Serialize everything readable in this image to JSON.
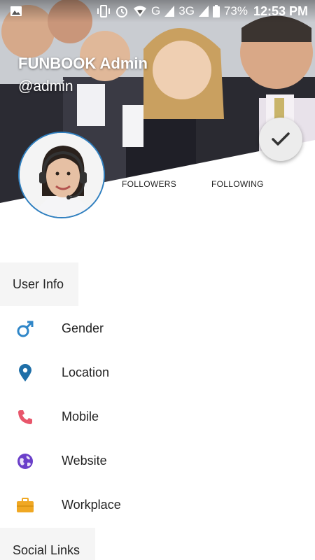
{
  "status_bar": {
    "battery": "73%",
    "time": "12:53 PM",
    "network_g": "G",
    "network_3g": "3G",
    "icons": [
      "image-icon",
      "vibrate-icon",
      "alarm-icon",
      "wifi-icon",
      "signal-icon",
      "signal-icon",
      "battery-icon"
    ]
  },
  "profile": {
    "name": "FUNBOOK Admin",
    "handle": "@admin"
  },
  "stats": {
    "followers_label": "FOLLOWERS",
    "following_label": "FOLLOWING"
  },
  "sections": {
    "user_info": "User Info",
    "social_links": "Social Links"
  },
  "info_items": [
    {
      "label": "Gender",
      "icon": "male-icon",
      "color": "#2f86c8"
    },
    {
      "label": "Location",
      "icon": "location-pin-icon",
      "color": "#1f6fa8"
    },
    {
      "label": "Mobile",
      "icon": "phone-icon",
      "color": "#e8566b"
    },
    {
      "label": "Website",
      "icon": "globe-icon",
      "color": "#6a3fc9"
    },
    {
      "label": "Workplace",
      "icon": "briefcase-icon",
      "color": "#f0a823"
    }
  ]
}
